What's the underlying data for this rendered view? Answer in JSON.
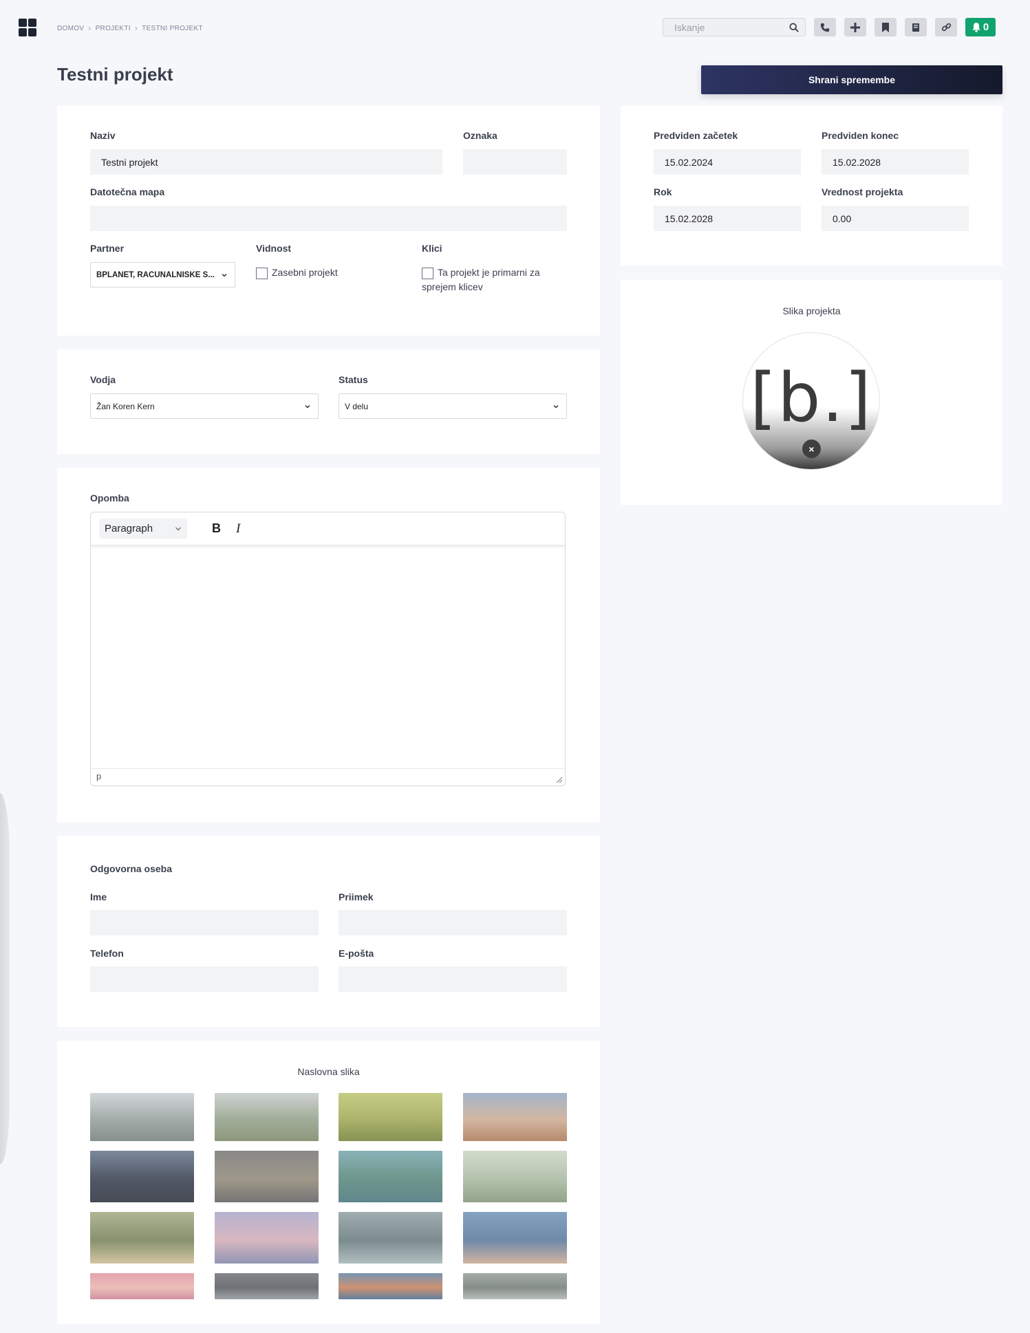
{
  "breadcrumb": [
    "DOMOV",
    "PROJEKTI",
    "TESTNI PROJEKT"
  ],
  "search": {
    "placeholder": "Iskanje"
  },
  "toolbar": {
    "icons": [
      "phone-icon",
      "plus-icon",
      "bookmark-icon",
      "book-icon",
      "link-icon"
    ],
    "notifications_count": "0",
    "accent": "#11a36f"
  },
  "page_title": "Testni projekt",
  "save_label": "Shrani spremembe",
  "main": {
    "naziv": {
      "label": "Naziv",
      "value": "Testni projekt"
    },
    "oznaka": {
      "label": "Oznaka",
      "value": ""
    },
    "datotecna_mapa": {
      "label": "Datotečna mapa",
      "value": ""
    },
    "partner": {
      "label": "Partner",
      "value": "BPLANET, RAČUNALNIŠKE S..."
    },
    "vidnost": {
      "label": "Vidnost",
      "checkbox_label": "Zasebni projekt",
      "checked": false
    },
    "klici": {
      "label": "Klici",
      "checkbox_label": "Ta projekt je primarni za sprejem klicev",
      "checked": false
    }
  },
  "assign": {
    "vodja": {
      "label": "Vodja",
      "value": "Žan Koren Kern"
    },
    "status": {
      "label": "Status",
      "value": "V delu"
    }
  },
  "note": {
    "label": "Opomba",
    "block_format": "Paragraph",
    "bold": "B",
    "italic": "I",
    "path": "p"
  },
  "contact": {
    "title": "Odgovorna oseba",
    "ime": {
      "label": "Ime",
      "value": ""
    },
    "priimek": {
      "label": "Priimek",
      "value": ""
    },
    "telefon": {
      "label": "Telefon",
      "value": ""
    },
    "eposta": {
      "label": "E-pošta",
      "value": ""
    }
  },
  "dates": {
    "zacetek": {
      "label": "Predviden začetek",
      "value": "15.02.2024"
    },
    "konec": {
      "label": "Predviden konec",
      "value": "15.02.2028"
    },
    "rok": {
      "label": "Rok",
      "value": "15.02.2028"
    },
    "vrednost": {
      "label": "Vrednost projekta",
      "value": "0.00"
    }
  },
  "project_image": {
    "title": "Slika projekta",
    "logo_text": "[b.]",
    "remove": "×"
  },
  "cover": {
    "title": "Naslovna slika",
    "thumbnails": [
      {
        "name": "thumb-lake-islands",
        "colors": [
          "#c9cdd0",
          "#8f9a96",
          "#6b7773"
        ]
      },
      {
        "name": "thumb-green-valley",
        "colors": [
          "#c4c9c7",
          "#8c9b83",
          "#73805e"
        ]
      },
      {
        "name": "thumb-bee-leaf",
        "colors": [
          "#b9c26a",
          "#9aa24a",
          "#6c7a2e"
        ]
      },
      {
        "name": "thumb-castle-sunset",
        "colors": [
          "#8ea4bf",
          "#c9a78c",
          "#a86f4e"
        ]
      },
      {
        "name": "thumb-earth-night",
        "colors": [
          "#5f6f86",
          "#2c3444",
          "#1d2330"
        ]
      },
      {
        "name": "thumb-yellow-flower",
        "colors": [
          "#6e6e6e",
          "#8a8270",
          "#575757"
        ]
      },
      {
        "name": "thumb-raindrops",
        "colors": [
          "#6fa0a8",
          "#4e7f72",
          "#3f6c74"
        ]
      },
      {
        "name": "thumb-kingfisher",
        "colors": [
          "#c9d4c0",
          "#a3b59a",
          "#7c9071"
        ]
      },
      {
        "name": "thumb-tree-field",
        "colors": [
          "#9ea77f",
          "#6d7a4d",
          "#c8b98e"
        ]
      },
      {
        "name": "thumb-city-dusk",
        "colors": [
          "#a6a2c6",
          "#cfa7b2",
          "#7a7fa4"
        ]
      },
      {
        "name": "thumb-palm-leaves",
        "colors": [
          "#8a9b9f",
          "#5f7276",
          "#9fb0b2"
        ]
      },
      {
        "name": "thumb-ocean-waves",
        "colors": [
          "#6a8fb2",
          "#4f7096",
          "#c8a38c"
        ]
      },
      {
        "name": "thumb-pink-sky",
        "colors": [
          "#dd8f9b",
          "#e7b1a9",
          "#c97a8c"
        ]
      },
      {
        "name": "thumb-motorbike",
        "colors": [
          "#6a6d72",
          "#4e5156",
          "#8b8f95"
        ]
      },
      {
        "name": "thumb-blue-orange",
        "colors": [
          "#5a7ea3",
          "#c37a52",
          "#3f6489"
        ]
      },
      {
        "name": "thumb-beetle",
        "colors": [
          "#8f9a93",
          "#6c7570",
          "#a9b1ab"
        ]
      }
    ]
  }
}
